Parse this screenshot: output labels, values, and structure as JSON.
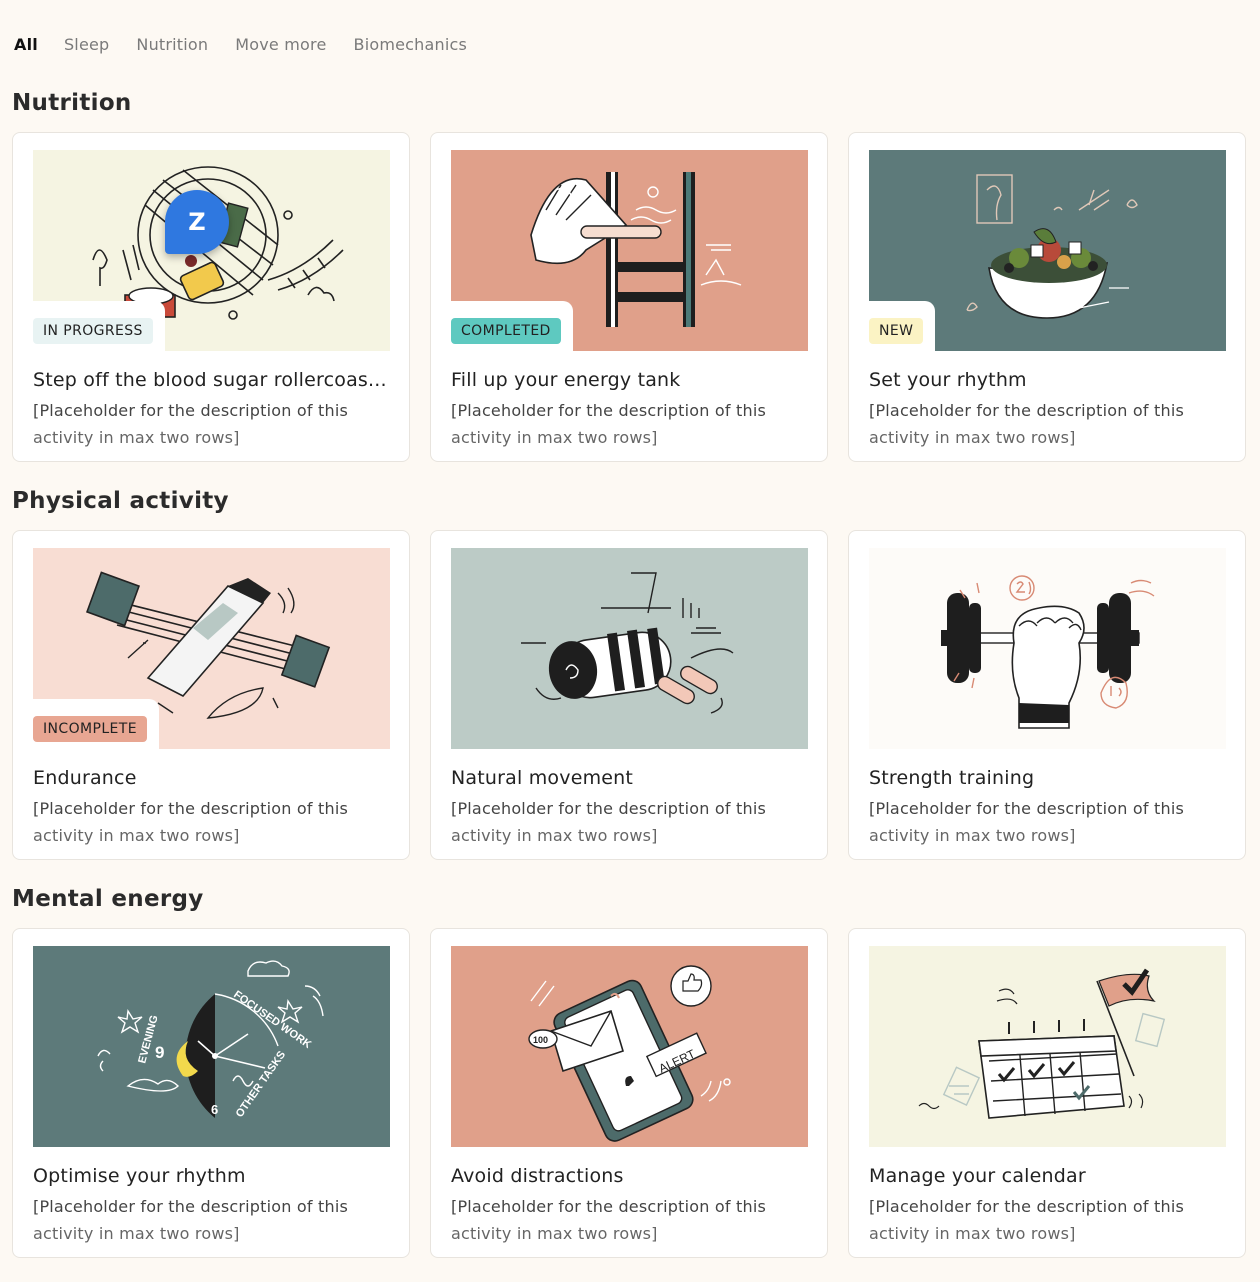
{
  "tabs": [
    {
      "label": "All",
      "active": true
    },
    {
      "label": "Sleep",
      "active": false
    },
    {
      "label": "Nutrition",
      "active": false
    },
    {
      "label": "Move more",
      "active": false
    },
    {
      "label": "Biomechanics",
      "active": false
    }
  ],
  "sections": [
    {
      "title": "Nutrition",
      "cards": [
        {
          "title": "Step off the blood sugar rollercoas...",
          "desc1": "[Placeholder for the description of this",
          "desc2": "activity in max two rows]",
          "badge": "IN PROGRESS",
          "badge_color": "#e8f3f3",
          "art_bg": "#f5f4e2",
          "icon": "rollercoaster-illustration-icon"
        },
        {
          "title": "Fill up your energy tank",
          "desc1": "[Placeholder for the description of this",
          "desc2": "activity in max two rows]",
          "badge": "COMPLETED",
          "badge_color": "#5ec9c0",
          "art_bg": "#e0a08a",
          "icon": "energy-ladder-illustration-icon"
        },
        {
          "title": "Set your rhythm",
          "desc1": "[Placeholder for the description of this",
          "desc2": "activity in max two rows]",
          "badge": "NEW",
          "badge_color": "#fbf3c4",
          "art_bg": "#5d7a7a",
          "icon": "salad-bowl-illustration-icon"
        }
      ]
    },
    {
      "title": "Physical activity",
      "cards": [
        {
          "title": "Endurance",
          "desc1": "[Placeholder for the description of this",
          "desc2": "activity in max two rows]",
          "badge": "INCOMPLETE",
          "badge_color": "#e8a692",
          "art_bg": "#f8ddd3",
          "icon": "resistance-band-illustration-icon"
        },
        {
          "title": "Natural movement",
          "desc1": "[Placeholder for the description of this",
          "desc2": "activity in max two rows]",
          "badge": "",
          "badge_color": "",
          "art_bg": "#bccbc6",
          "icon": "foam-roller-illustration-icon"
        },
        {
          "title": "Strength training",
          "desc1": "[Placeholder for the description of this",
          "desc2": "activity in max two rows]",
          "badge": "",
          "badge_color": "",
          "art_bg": "#fdfbf8",
          "icon": "dumbbell-illustration-icon"
        }
      ]
    },
    {
      "title": "Mental energy",
      "cards": [
        {
          "title": "Optimise your rhythm",
          "desc1": "[Placeholder for the description of this",
          "desc2": "activity in max two rows]",
          "badge": "",
          "badge_color": "",
          "art_bg": "#5d7a7a",
          "icon": "day-clock-illustration-icon",
          "art_text": [
            "EVENING",
            "FOCUSED WORK",
            "OTHER TASKS",
            "9",
            "6"
          ]
        },
        {
          "title": "Avoid distractions",
          "desc1": "[Placeholder for the description of this",
          "desc2": "activity in max two rows]",
          "badge": "",
          "badge_color": "",
          "art_bg": "#e0a08a",
          "icon": "phone-alert-illustration-icon",
          "art_text": [
            "100",
            "ALERT"
          ]
        },
        {
          "title": "Manage your calendar",
          "desc1": "[Placeholder for the description of this",
          "desc2": "activity in max two rows]",
          "badge": "",
          "badge_color": "",
          "art_bg": "#f5f4e2",
          "icon": "calendar-illustration-icon"
        }
      ]
    }
  ],
  "chat_bubble": {
    "letter": "Z",
    "color": "#2f78e0"
  }
}
